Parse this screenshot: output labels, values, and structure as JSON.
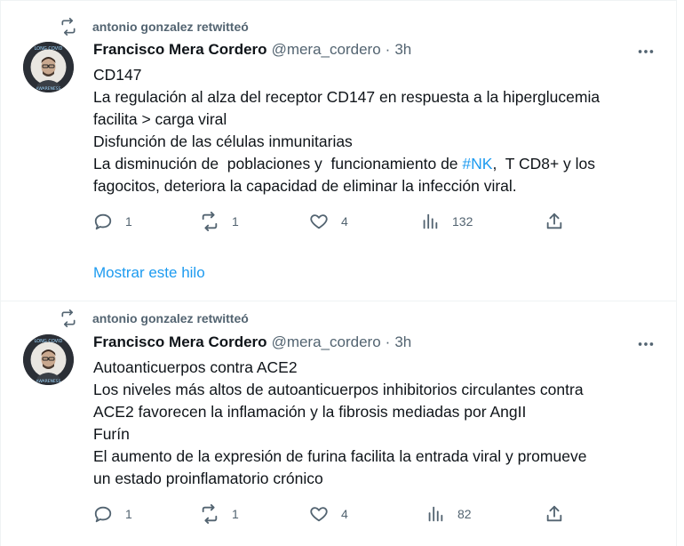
{
  "tweets": [
    {
      "retweeted_by": "antonio gonzalez retwitteó",
      "author_name": "Francisco Mera Cordero",
      "handle": "@mera_cordero",
      "separator": "·",
      "time": "3h",
      "lines": [
        "CD147",
        "La regulación al alza del receptor CD147 en respuesta a la hiperglucemia",
        "facilita > carga viral",
        "Disfunción de las células inmunitarias"
      ],
      "line5_prefix": "La disminución de  poblaciones y  funcionamiento de ",
      "line5_hashtag": "#NK",
      "line5_suffix": ",  T CD8+ y los",
      "line6": "fagocitos, deteriora la capacidad de eliminar la infección viral.",
      "replies": "1",
      "retweets": "1",
      "likes": "4",
      "views": "132",
      "show_thread": "Mostrar este hilo"
    },
    {
      "retweeted_by": "antonio gonzalez retwitteó",
      "author_name": "Francisco Mera Cordero",
      "handle": "@mera_cordero",
      "separator": "·",
      "time": "3h",
      "lines": [
        "Autoanticuerpos contra ACE2",
        "Los niveles más altos de autoanticuerpos inhibitorios circulantes contra",
        "ACE2 favorecen la inflamación y la fibrosis mediadas por AngII",
        "Furín",
        "El aumento de la expresión de furina facilita la entrada viral y promueve",
        "un estado proinflamatorio crónico"
      ],
      "replies": "1",
      "retweets": "1",
      "likes": "4",
      "views": "82"
    }
  ],
  "avatar_text": "LONG COVID AWARENESS",
  "colors": {
    "accent": "#1d9bf0",
    "muted": "#536471",
    "text": "#0f1419",
    "border": "#eff3f4"
  }
}
